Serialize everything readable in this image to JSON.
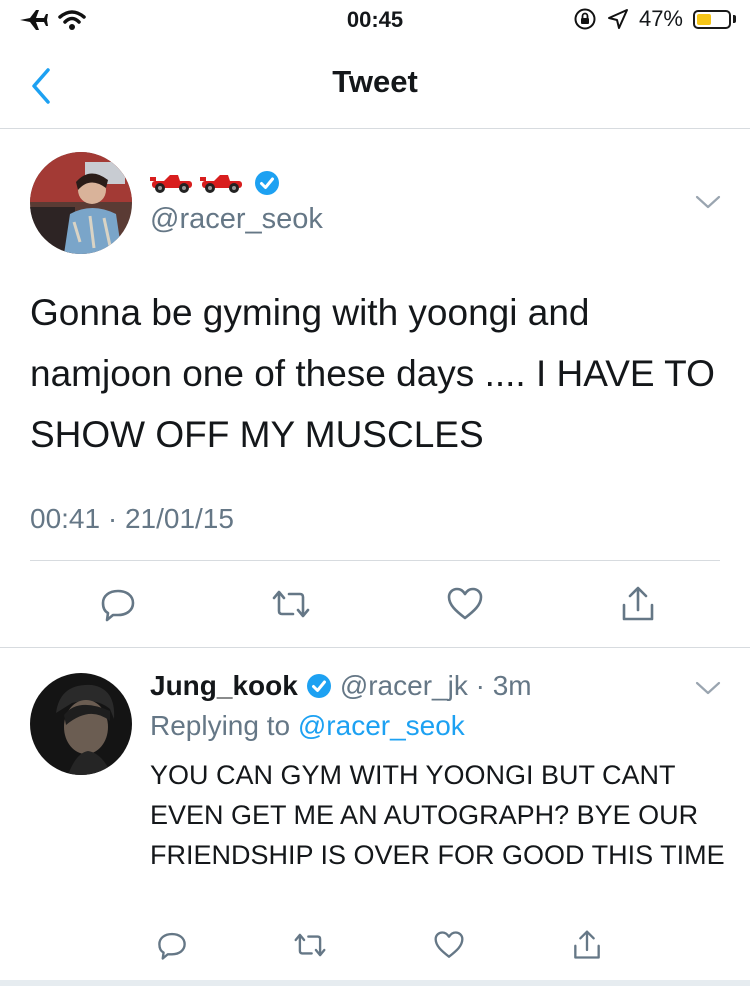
{
  "status_bar": {
    "time": "00:45",
    "battery_text": "47%",
    "battery_level": 0.47,
    "battery_color": "#f5c518",
    "icons": [
      "airplane-icon",
      "wifi-icon",
      "rotation-lock-icon",
      "location-arrow-icon",
      "battery-icon"
    ]
  },
  "nav": {
    "title": "Tweet",
    "back_icon": "chevron-left-icon"
  },
  "main_tweet": {
    "display_name_emoji": "🏎🏎",
    "handle": "@racer_seok",
    "text": "Gonna be gyming with yoongi and namjoon one of these days .... I HAVE TO SHOW OFF MY MUSCLES",
    "timestamp": "00:41 · 21/01/15",
    "verified": true
  },
  "reply_tweet": {
    "display_name": "Jung_kook",
    "handle_time": "@racer_jk · 3m",
    "replying_prefix": "Replying to ",
    "replying_handle": "@racer_seok",
    "text": "YOU CAN GYM WITH YOONGI BUT CANT EVEN GET ME AN AUTOGRAPH? BYE OUR FRIENDSHIP IS OVER FOR GOOD THIS TIME",
    "verified": true
  },
  "colors": {
    "accent": "#1da1f2",
    "verified_badge": "#1da1f2",
    "secondary_text": "#657786",
    "divider": "#d7dbdf"
  }
}
